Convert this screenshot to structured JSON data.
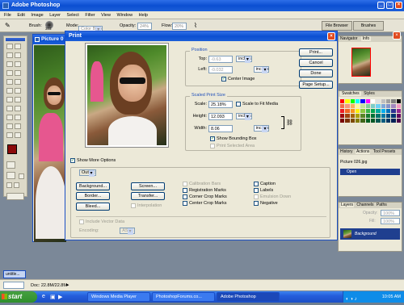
{
  "app": {
    "title": "Adobe Photoshop",
    "menu": [
      "File",
      "Edit",
      "Image",
      "Layer",
      "Select",
      "Filter",
      "View",
      "Window",
      "Help"
    ],
    "options": {
      "brush_label": "Brush:",
      "brush_size": "303",
      "mode_label": "Mode:",
      "mode_value": "Color Burn",
      "opacity_label": "Opacity:",
      "opacity_value": "24%",
      "flow_label": "Flow:",
      "flow_value": "20%"
    },
    "palette_well": [
      "File Browser",
      "Brushes"
    ],
    "doc_title": "Picture 0",
    "status": "Doc: 22.8M/22.8M",
    "minimized_doc": "untitle..."
  },
  "print_dialog": {
    "title": "Print",
    "position": {
      "legend": "Position",
      "top_label": "Top:",
      "top_value": "-0.63",
      "top_unit": "inches",
      "left_label": "Left:",
      "left_value": "-0.032",
      "left_unit": "inches",
      "center_label": "Center Image"
    },
    "scaled": {
      "legend": "Scaled Print Size",
      "scale_label": "Scale:",
      "scale_value": "25.18%",
      "fit_label": "Scale to Fit Media",
      "height_label": "Height:",
      "height_value": "12.093",
      "height_unit": "inches",
      "width_label": "Width:",
      "width_value": "8.06",
      "width_unit": "inches",
      "bbox_label": "Show Bounding Box",
      "selected_label": "Print Selected Area"
    },
    "buttons": {
      "print": "Print...",
      "cancel": "Cancel",
      "done": "Done",
      "page_setup": "Page Setup..."
    },
    "more_options_label": "Show More Options",
    "output_select": "Output",
    "output_buttons": {
      "background": "Background...",
      "border": "Border...",
      "bleed": "Bleed...",
      "screen": "Screen...",
      "transfer": "Transfer...",
      "interpolation": "Interpolation"
    },
    "checks_col1": [
      {
        "label": "Calibration Bars",
        "disabled": true
      },
      {
        "label": "Registration Marks",
        "disabled": false
      },
      {
        "label": "Corner Crop Marks",
        "disabled": false
      },
      {
        "label": "Center Crop Marks",
        "disabled": false
      }
    ],
    "checks_col2": [
      {
        "label": "Caption",
        "disabled": false
      },
      {
        "label": "Labels",
        "disabled": false
      },
      {
        "label": "Emulsion Down",
        "disabled": true
      },
      {
        "label": "Negative",
        "disabled": false
      }
    ],
    "vector_label": "Include Vector Data",
    "encoding_label": "Encoding:",
    "encoding_value": "ASCII"
  },
  "panels": {
    "navigator_tabs": [
      "Navigator",
      "Info"
    ],
    "swatch_tabs": [
      "Swatches",
      "Styles"
    ],
    "history_tabs": [
      "History",
      "Actions",
      "Tool Presets"
    ],
    "history_items": [
      "Picture 026.jpg",
      "Open"
    ],
    "layers_tabs": [
      "Layers",
      "Channels",
      "Paths"
    ],
    "opacity_label": "Opacity:",
    "opacity_value": "100%",
    "fill_label": "Fill:",
    "fill_value": "100%",
    "layer_name": "Background",
    "swatch_colors": [
      "#ff0000",
      "#ffff00",
      "#00ff00",
      "#00ffff",
      "#0000ff",
      "#ff00ff",
      "#ffffff",
      "#e0e0e0",
      "#c0c0c0",
      "#a0a0a0",
      "#808080",
      "#000000",
      "#f26c4f",
      "#f7977a",
      "#fbaf5d",
      "#fff79a",
      "#c4df9b",
      "#82ca9d",
      "#7bcdc8",
      "#6ecff6",
      "#7ea7d8",
      "#8493ca",
      "#a187be",
      "#f49ac2",
      "#ed1c24",
      "#f26522",
      "#f7941d",
      "#fff200",
      "#8dc73f",
      "#39b54a",
      "#00a651",
      "#00a99d",
      "#00aeef",
      "#0072bc",
      "#2e3192",
      "#92278f",
      "#9e0b0f",
      "#a0410d",
      "#a3620a",
      "#aba000",
      "#598527",
      "#197b30",
      "#007236",
      "#00746b",
      "#0076a3",
      "#004a80",
      "#003471",
      "#630460",
      "#790000",
      "#7b2e00",
      "#7d4900",
      "#827b00",
      "#406618",
      "#005e20",
      "#005826",
      "#005952",
      "#005b7f",
      "#003663",
      "#002157",
      "#4b0049"
    ]
  },
  "taskbar": {
    "start": "start",
    "tasks": [
      "Windows Media Player",
      "PhotoshopForums.co...",
      "Adobe Photoshop"
    ],
    "clock": "10:05 AM"
  }
}
